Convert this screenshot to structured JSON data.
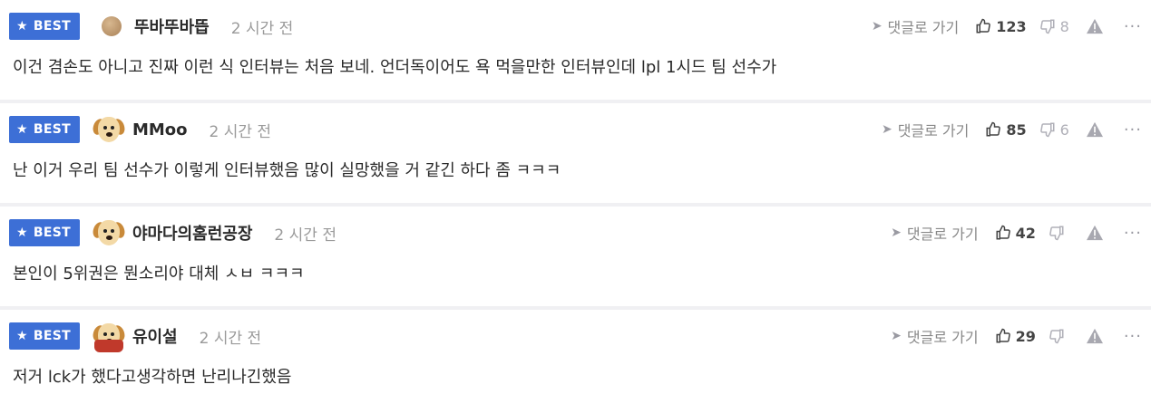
{
  "labels": {
    "badge": "BEST",
    "reply": "댓글로 가기",
    "more": "···"
  },
  "colors": {
    "badge_bg": "#3d6fd6",
    "text": "#2a2a2a",
    "muted": "#9a9a9a"
  },
  "comments": [
    {
      "nickname": "뚜바뚜바뜹",
      "avatar": "orb-avatar",
      "time": "2 시간 전",
      "up": "123",
      "down": "8",
      "text": "이건 겸손도 아니고 진짜 이런 식 인터뷰는 처음 보네. 언더독이어도 욕 먹을만한 인터뷰인데 lpl 1시드 팀 선수가"
    },
    {
      "nickname": "MMoo",
      "avatar": "dog-avatar",
      "time": "2 시간 전",
      "up": "85",
      "down": "6",
      "text": "난 이거 우리 팀 선수가 이렇게 인터뷰했음 많이 실망했을 거 같긴 하다 좀 ㅋㅋㅋ"
    },
    {
      "nickname": "야마다의홈런공장",
      "avatar": "dog-avatar",
      "time": "2 시간 전",
      "up": "42",
      "down": "",
      "text": "본인이 5위권은 뭔소리야 대체 ㅅㅂ ㅋㅋㅋ"
    },
    {
      "nickname": "유이설",
      "avatar": "caped-dog-avatar",
      "time": "2 시간 전",
      "up": "29",
      "down": "",
      "text": "저거 lck가 했다고생각하면 난리나긴했음"
    }
  ]
}
